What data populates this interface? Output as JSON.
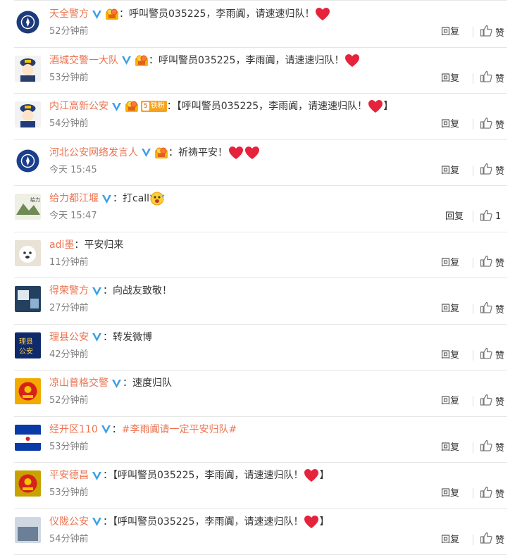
{
  "comments": [
    {
      "user": "天全警方",
      "medal": true,
      "fan": null,
      "text": "：呼叫警员035225，李雨阗，请速速归队！",
      "hearts": 1,
      "bracket": false,
      "time": "52分钟前",
      "reply": "回复",
      "like": "赞",
      "avatar_color": "#1d3a7a"
    },
    {
      "user": "酒城交警一大队",
      "medal": true,
      "fan": null,
      "text": "：呼叫警员035225，李雨阗，请速速归队！",
      "hearts": 1,
      "bracket": false,
      "time": "53分钟前",
      "reply": "回复",
      "like": "赞",
      "avatar_color": "#2a3e6b"
    },
    {
      "user": "内江高新公安",
      "medal": true,
      "fan": {
        "level": "5",
        "label": "铁粉"
      },
      "text": "：【呼叫警员035225，李雨阗，请速速归队！",
      "hearts": 1,
      "bracket": true,
      "time": "54分钟前",
      "reply": "回复",
      "like": "赞",
      "avatar_color": "#223b7a"
    },
    {
      "user": "河北公安网络发言人",
      "medal": true,
      "fan": null,
      "text": "：祈祷平安！",
      "hearts": 2,
      "bracket": false,
      "time": "今天 15:45",
      "reply": "回复",
      "like": "赞",
      "avatar_color": "#1a3f8c"
    },
    {
      "user": "给力都江堰",
      "medal": false,
      "fan": null,
      "text": "：打call",
      "hearts": 0,
      "bracket": false,
      "emoji": true,
      "time": "今天 15:47",
      "reply": "回复",
      "like": "1",
      "avatar_color": "#6f8a55"
    },
    {
      "user": "adi墨",
      "medal": false,
      "fan": null,
      "vip": false,
      "text": "：平安归来",
      "hearts": 0,
      "bracket": false,
      "time": "11分钟前",
      "reply": "回复",
      "like": "赞",
      "avatar_color": "#d9cbb4"
    },
    {
      "user": "得荣警方",
      "medal": false,
      "fan": null,
      "text": "：向战友致敬！",
      "hearts": 0,
      "bracket": false,
      "time": "27分钟前",
      "reply": "回复",
      "like": "赞",
      "avatar_color": "#23405f"
    },
    {
      "user": "理县公安",
      "medal": false,
      "fan": null,
      "text": "：转发微博",
      "hearts": 0,
      "bracket": false,
      "time": "42分钟前",
      "reply": "回复",
      "like": "赞",
      "avatar_color": "#0f2a6a"
    },
    {
      "user": "凉山普格交警",
      "medal": false,
      "fan": null,
      "text": "：速度归队",
      "hearts": 0,
      "bracket": false,
      "time": "52分钟前",
      "reply": "回复",
      "like": "赞",
      "avatar_color": "#f2a900"
    },
    {
      "user": "经开区110",
      "medal": false,
      "fan": null,
      "text": "：",
      "topic": "#李雨阗请一定平安归队#",
      "hearts": 0,
      "bracket": false,
      "time": "53分钟前",
      "reply": "回复",
      "like": "赞",
      "avatar_color": "#0a3aa8"
    },
    {
      "user": "平安德昌",
      "medal": false,
      "fan": null,
      "text": "：【呼叫警员035225，李雨阗，请速速归队！",
      "hearts": 1,
      "bracket": true,
      "time": "53分钟前",
      "reply": "回复",
      "like": "赞",
      "avatar_color": "#c8a200"
    },
    {
      "user": "仪陇公安",
      "medal": false,
      "fan": null,
      "text": "：【呼叫警员035225，李雨阗，请速速归队！",
      "hearts": 1,
      "bracket": true,
      "time": "54分钟前",
      "reply": "回复",
      "like": "赞",
      "avatar_color": "#6b7f96"
    }
  ],
  "colors": {
    "username": "#eb7350",
    "verified": "#3aa0e6",
    "heart": "#e5233c",
    "time": "#808080"
  }
}
